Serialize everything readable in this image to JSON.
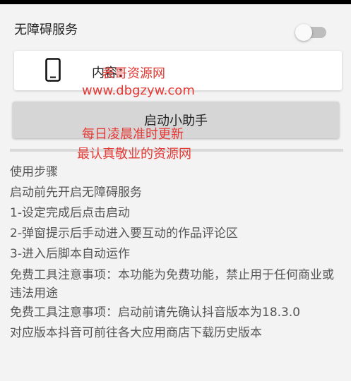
{
  "accessibility": {
    "label": "无障碍服务",
    "toggle_on": false
  },
  "content_card": {
    "icon": "phone-icon",
    "text": "内容："
  },
  "start_button": {
    "label": "启动小助手"
  },
  "instructions": [
    "使用步骤",
    "启动前先开启无障碍服务",
    "1-设定完成后点击启动",
    "2-弹窗提示后手动进入要互动的作品评论区",
    "3-进入后脚本自动运作",
    "免费工具注意事项：本功能为免费功能，禁止用于任何商业或违法用途",
    "免费工具注意事项：启动前请先确认抖音版本为18.3.0",
    "对应版本抖音可前往各大应用商店下载历史版本"
  ],
  "watermark": {
    "line1": "表哥资源网",
    "line2": "www.dbgzyw.com",
    "line3": "每日凌晨准时更新",
    "line4": "最认真敬业的资源网",
    "color": "#e53935"
  }
}
